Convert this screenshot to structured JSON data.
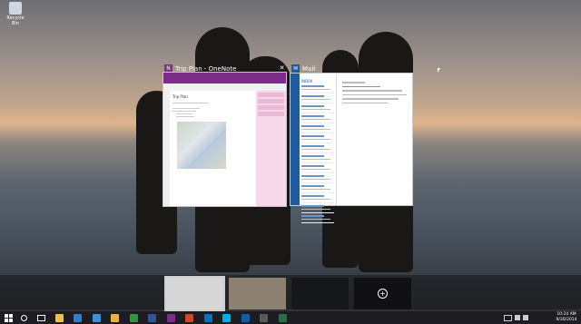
{
  "desktop": {
    "recycle_bin_label": "Recycle Bin",
    "cursor_icon": "arrow-cursor-icon"
  },
  "windows": [
    {
      "title": "Trip Plan - OneNote",
      "icon": "onenote-icon",
      "accent": "#7b2d89",
      "page_title": "Trip Plan"
    },
    {
      "title": "Mail",
      "icon": "mail-icon",
      "accent": "#1d5c9f",
      "inbox_label": "INBOX"
    }
  ],
  "task_view": {
    "add_desktop_icon": "plus-icon"
  },
  "taskbar": {
    "start_icon": "windows-logo-icon",
    "search_icon": "search-icon",
    "task_view_icon": "task-view-icon",
    "pinned": [
      {
        "name": "file-explorer-icon",
        "color": "#f0c040"
      },
      {
        "name": "mail-app-icon",
        "color": "#2d7dd2"
      },
      {
        "name": "internet-explorer-icon",
        "color": "#3c8fd9"
      },
      {
        "name": "folder-icon",
        "color": "#e8b33a"
      },
      {
        "name": "store-icon",
        "color": "#2b9a3b"
      },
      {
        "name": "word-icon",
        "color": "#2b5797"
      },
      {
        "name": "onenote-app-icon",
        "color": "#7b2d89"
      },
      {
        "name": "powerpoint-icon",
        "color": "#d24726"
      },
      {
        "name": "outlook-icon",
        "color": "#0072c6"
      },
      {
        "name": "skype-icon",
        "color": "#00aff0"
      },
      {
        "name": "lync-icon",
        "color": "#0f5ea8"
      },
      {
        "name": "settings-icon",
        "color": "#5a5a5a"
      },
      {
        "name": "excel-icon",
        "color": "#217346"
      }
    ],
    "clock_time": "10:24 AM",
    "clock_date": "9/30/2014"
  }
}
